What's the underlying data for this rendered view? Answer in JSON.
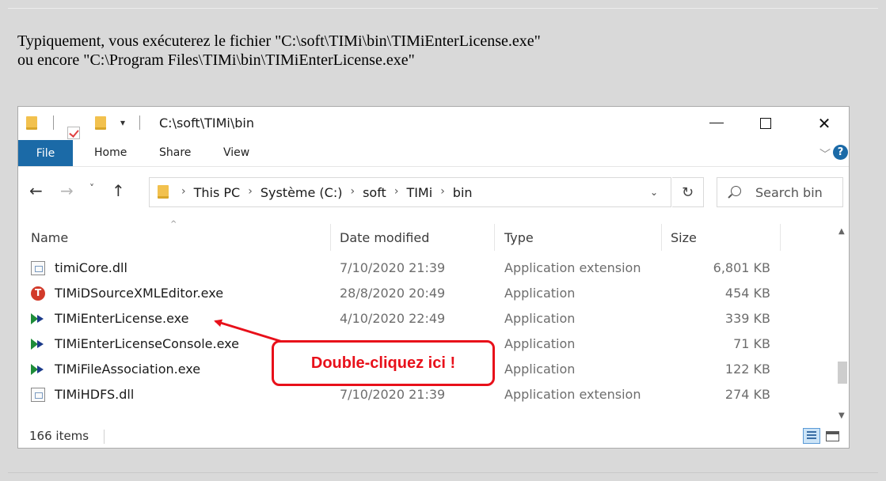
{
  "intro": {
    "line1": "Typiquement, vous exécuterez le fichier \"C:\\soft\\TIMi\\bin\\TIMiEnterLicense.exe\"",
    "line2": "ou encore \"C:\\Program Files\\TIMi\\bin\\TIMiEnterLicense.exe\""
  },
  "window": {
    "title": "C:\\soft\\TIMi\\bin",
    "qa_dropdown_glyph": "▾",
    "close_glyph": "✕"
  },
  "ribbon": {
    "tabs": [
      "File",
      "Home",
      "Share",
      "View"
    ],
    "collapse_glyph": "﹀",
    "help_glyph": "?"
  },
  "nav": {
    "back_glyph": "←",
    "forward_glyph": "→",
    "recent_glyph": "˅",
    "up_glyph": "↑",
    "breadcrumbs": [
      "This PC",
      "Système (C:)",
      "soft",
      "TIMi",
      "bin"
    ],
    "crumb_separator": "›",
    "address_dropdown_glyph": "⌄",
    "refresh_glyph": "↻",
    "search_placeholder": "Search bin"
  },
  "columns": {
    "name": "Name",
    "date": "Date modified",
    "type": "Type",
    "size": "Size",
    "sort_glyph": "^"
  },
  "files": [
    {
      "name": "timiCore.dll",
      "date": "7/10/2020 21:39",
      "type": "Application extension",
      "size": "6,801 KB",
      "icon": "dll-icon"
    },
    {
      "name": "TIMiDSourceXMLEditor.exe",
      "date": "28/8/2020 20:49",
      "type": "Application",
      "size": "454 KB",
      "icon": "timi-app-icon"
    },
    {
      "name": "TIMiEnterLicense.exe",
      "date": "4/10/2020 22:49",
      "type": "Application",
      "size": "339 KB",
      "icon": "timi-run-icon"
    },
    {
      "name": "TIMiEnterLicenseConsole.exe",
      "date": "",
      "type": "Application",
      "size": "71 KB",
      "icon": "timi-run-icon"
    },
    {
      "name": "TIMiFileAssociation.exe",
      "date": "",
      "type": "Application",
      "size": "122 KB",
      "icon": "timi-run-icon"
    },
    {
      "name": "TIMiHDFS.dll",
      "date": "7/10/2020 21:39",
      "type": "Application extension",
      "size": "274 KB",
      "icon": "dll-icon"
    }
  ],
  "status": {
    "item_count": "166 items"
  },
  "annotation": {
    "callout": "Double-cliquez ici !",
    "color": "#e8101a"
  },
  "colors": {
    "file_tab": "#1b6aa7",
    "background": "#d9d9d9"
  }
}
